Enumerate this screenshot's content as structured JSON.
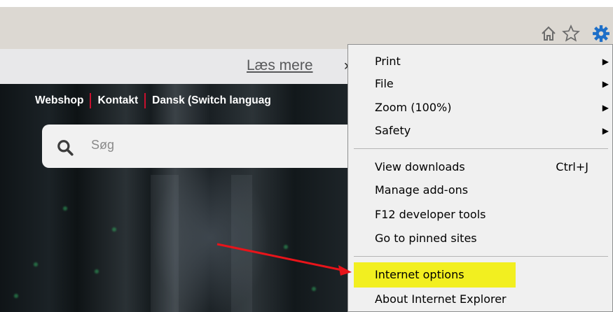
{
  "toolbar": {
    "icons": [
      "home-icon",
      "star-icon",
      "gear-icon"
    ]
  },
  "infobar": {
    "link_text": "Læs mere",
    "trailing_char": "›"
  },
  "site": {
    "nav": [
      "Webshop",
      "Kontakt",
      "Dansk (Switch languag"
    ],
    "search_placeholder": "Søg"
  },
  "menu": {
    "items": [
      {
        "label": "Print",
        "submenu": true
      },
      {
        "label": "File",
        "submenu": true
      },
      {
        "label": "Zoom (100%)",
        "submenu": true
      },
      {
        "label": "Safety",
        "submenu": true
      },
      {
        "label": "View downloads",
        "shortcut": "Ctrl+J"
      },
      {
        "label": "Manage add-ons"
      },
      {
        "label": "F12 developer tools"
      },
      {
        "label": "Go to pinned sites"
      },
      {
        "label": "Internet options",
        "highlighted": true
      },
      {
        "label": "About Internet Explorer"
      }
    ]
  },
  "colors": {
    "highlight": "#f2ef20",
    "annotation_arrow": "#e8141a",
    "gear": "#1e6fc8",
    "nav_separator": "#c8102e"
  }
}
